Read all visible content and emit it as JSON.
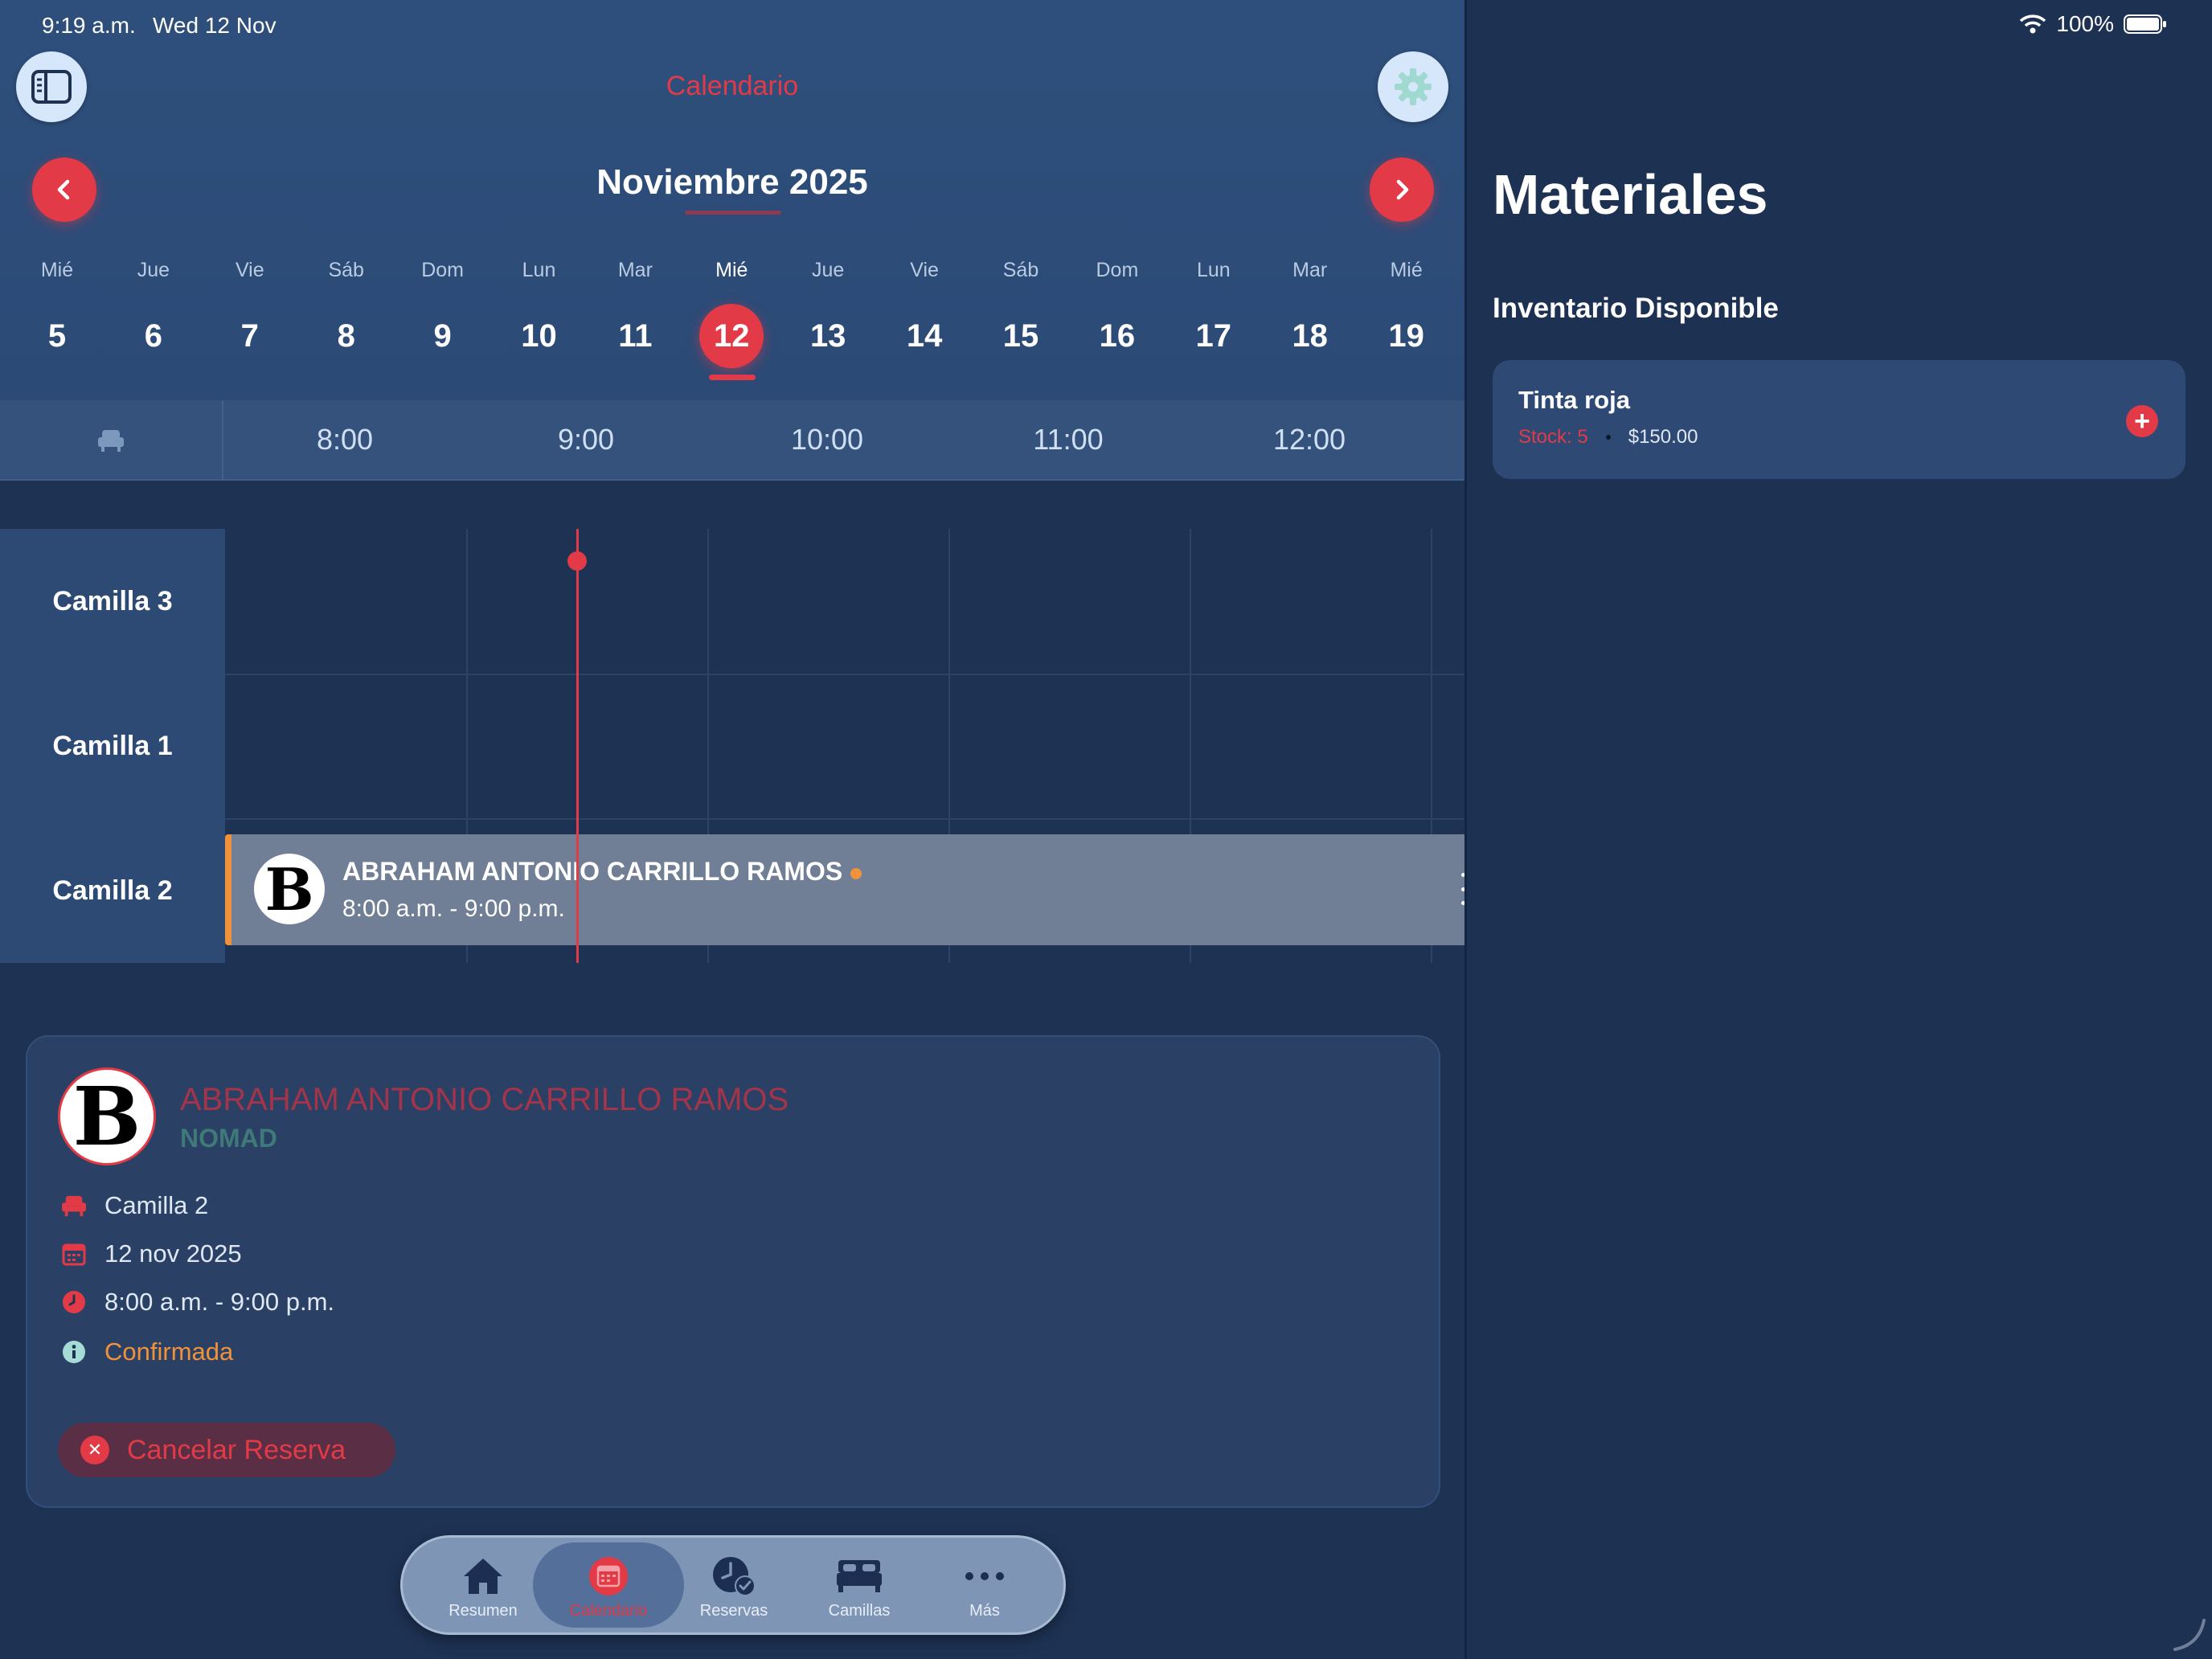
{
  "status_bar": {
    "time": "9:19 a.m.",
    "date": "Wed 12 Nov",
    "battery": "100%"
  },
  "nav": {
    "title": "Calendario",
    "month": "Noviembre 2025"
  },
  "week": [
    {
      "name": "Mié",
      "num": "5"
    },
    {
      "name": "Jue",
      "num": "6"
    },
    {
      "name": "Vie",
      "num": "7"
    },
    {
      "name": "Sáb",
      "num": "8"
    },
    {
      "name": "Dom",
      "num": "9"
    },
    {
      "name": "Lun",
      "num": "10"
    },
    {
      "name": "Mar",
      "num": "11"
    },
    {
      "name": "Mié",
      "num": "12"
    },
    {
      "name": "Jue",
      "num": "13"
    },
    {
      "name": "Vie",
      "num": "14"
    },
    {
      "name": "Sáb",
      "num": "15"
    },
    {
      "name": "Dom",
      "num": "16"
    },
    {
      "name": "Lun",
      "num": "17"
    },
    {
      "name": "Mar",
      "num": "18"
    },
    {
      "name": "Mié",
      "num": "19"
    }
  ],
  "selected_day": "12",
  "hours": [
    "8:00",
    "9:00",
    "10:00",
    "11:00",
    "12:00"
  ],
  "rows": [
    "Camilla 3",
    "Camilla 1",
    "Camilla 2"
  ],
  "event": {
    "name": "ABRAHAM ANTONIO CARRILLO RAMOS",
    "time": "8:00 a.m. - 9:00 p.m.",
    "avatar_letter": "B",
    "status_color": "#f0923c"
  },
  "detail": {
    "name": "ABRAHAM ANTONIO CARRILLO RAMOS",
    "subtitle": "NOMAD",
    "bed": "Camilla 2",
    "date": "12 nov 2025",
    "time": "8:00 a.m. - 9:00 p.m.",
    "status": "Confirmada",
    "cancel_label": "Cancelar Reserva"
  },
  "tabs": [
    {
      "label": "Resumen",
      "icon": "house-icon"
    },
    {
      "label": "Calendario",
      "icon": "calendar-icon",
      "active": true
    },
    {
      "label": "Reservas",
      "icon": "clock-check-icon"
    },
    {
      "label": "Camillas",
      "icon": "bed-icon"
    },
    {
      "label": "Más",
      "icon": "more-icon"
    }
  ],
  "materials": {
    "title": "Materiales",
    "section": "Inventario Disponible",
    "items": [
      {
        "name": "Tinta roja",
        "stock": "Stock: 5",
        "price": "$150.00"
      }
    ]
  },
  "colors": {
    "accent": "#e23a46",
    "background": "#1d3153",
    "header": "#2e4f7c",
    "status_orange": "#f0923c"
  }
}
